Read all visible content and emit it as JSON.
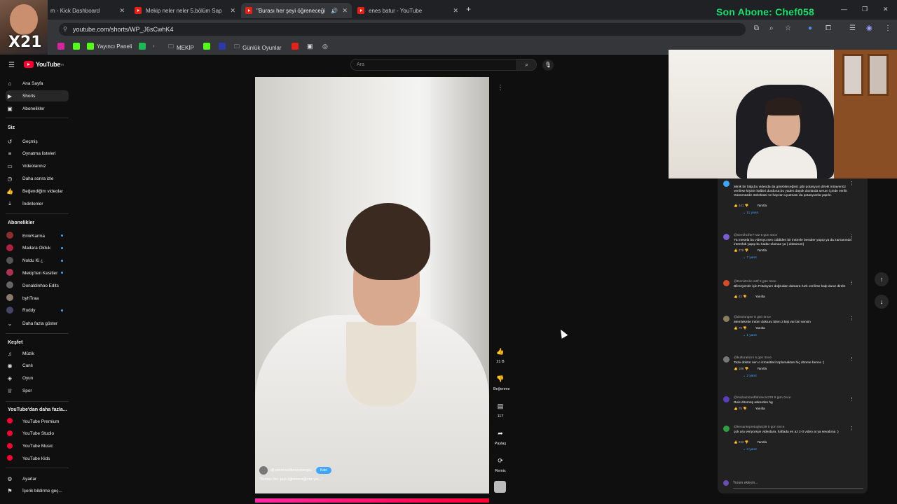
{
  "browser": {
    "tabs": [
      {
        "title": "m - Kick Dashboard",
        "close": "✕"
      },
      {
        "title": "Mekip neler neler 5.bölüm Sap",
        "close": "✕"
      },
      {
        "title": "\"Burası her şeyi öğreneceği",
        "close": "✕"
      },
      {
        "title": "enes batur - YouTube",
        "close": "✕"
      }
    ],
    "new_tab": "+",
    "url": "youtube.com/shorts/WP_J6sCwhK4",
    "bookmarks": [
      "Yayıncı Paneli",
      "MEKİP",
      "Günlük Oyunlar"
    ],
    "overlay_text": "Son Abone: Chef058",
    "window_controls": [
      "—",
      "❐",
      "✕"
    ],
    "facecam_label": "X21"
  },
  "youtube": {
    "logo": "YouTube",
    "logo_sup": "TR",
    "search_placeholder": "Ara",
    "sidebar": {
      "main": [
        {
          "label": "Ana Sayfa",
          "icon": "⌂"
        },
        {
          "label": "Shorts",
          "icon": "▶"
        },
        {
          "label": "Abonelikler",
          "icon": "▣"
        }
      ],
      "you_header": "Siz",
      "you": [
        {
          "label": "Geçmiş",
          "icon": "↺"
        },
        {
          "label": "Oynatma listeleri",
          "icon": "≡"
        },
        {
          "label": "Videolarınız",
          "icon": "▭"
        },
        {
          "label": "Daha sonra izle",
          "icon": "◷"
        },
        {
          "label": "Beğendiğim videolar",
          "icon": "👍"
        },
        {
          "label": "İndirilenler",
          "icon": "⤓"
        }
      ],
      "subs_header": "Abonelikler",
      "subs": [
        {
          "label": "EmirKarma",
          "color": "#8e2d2d",
          "dot": true
        },
        {
          "label": "Madara Olduk",
          "color": "#b02040",
          "dot": true
        },
        {
          "label": "Noldu Ki ¿",
          "color": "#555555",
          "dot": true
        },
        {
          "label": "Mekip'ten Kesitler",
          "color": "#b03050",
          "dot": true
        },
        {
          "label": "Donaldinhoo Edits",
          "color": "#666666",
          "dot": false
        },
        {
          "label": "byhTraa",
          "color": "#8a7a6a",
          "dot": false
        },
        {
          "label": "Ruddy",
          "color": "#444466",
          "dot": true
        }
      ],
      "show_more": "Daha fazla göster",
      "explore_header": "Keşfet",
      "explore": [
        {
          "label": "Müzik",
          "icon": "♫"
        },
        {
          "label": "Canlı",
          "icon": "◉"
        },
        {
          "label": "Oyun",
          "icon": "◈"
        },
        {
          "label": "Spor",
          "icon": "♕"
        }
      ],
      "more_header": "YouTube'dan daha fazla...",
      "more": [
        {
          "label": "YouTube Premium"
        },
        {
          "label": "YouTube Studio"
        },
        {
          "label": "YouTube Music"
        },
        {
          "label": "YouTube Kids"
        }
      ],
      "settings": [
        {
          "label": "Ayarlar",
          "icon": "⚙"
        },
        {
          "label": "İçerik bildirme geç...",
          "icon": "⚑"
        }
      ]
    },
    "short": {
      "channel": "@umutcandenizyasoglu",
      "subscribe": "Katıl",
      "caption": "\"Burası her şeyi öğreneceğimiz yer...\"",
      "likes": "21 B",
      "dislike": "Beğenme",
      "comments_count": "117",
      "share": "Paylaş",
      "remix": "Remix"
    },
    "comments": [
      {
        "user": "",
        "time": "",
        "text": "Minik bir bilgi,bu videoda da görebileceğiniz gibi potasyum direkt intravenöz verilirse kişinin kalbini durdurur,bu yüden düşük dozlarda serum içinde verilir. Günümüzde ötelektasi ve hayvan uyutması da potasyumla yapılır.",
        "likes": "441",
        "reply": "Yanıtla",
        "replies": "11 yanıt",
        "color": "#3ea6ff"
      },
      {
        "user": "@semihcifte7732",
        "time": "5 gün önce",
        "text": "Ya mesela bu videoyu sen ciddiden bir intörnle beraber yapıp ya da zamanında intörnlük yapıp bu kadar olamaz ya ( doktorum)",
        "likes": "276",
        "reply": "Yanıtla",
        "replies": "7 yanıt",
        "color": "#7b5cd6"
      },
      {
        "user": "@DenizKılıc-w8f",
        "time": "5 gün önce",
        "text": "Bilmeyenler için Potasyum doğrudan damara hızlı verilirse kalp durur direkt",
        "likes": "42",
        "reply": "Yanıtla",
        "replies": "",
        "color": "#d84a2a"
      },
      {
        "user": "@drstrongee",
        "time": "5 gün önce",
        "text": "Memlekette intöm dokturu bilen 3 kişi var biri sensin",
        "likes": "79",
        "reply": "Yanıtla",
        "replies": "1 yanıt",
        "color": "#8a8060"
      },
      {
        "user": "@kulturaticini",
        "time": "5 gün önce",
        "text": "Taze doktor sen o izmaritleri toplamaktan hiç dönme bence :)",
        "likes": "186",
        "reply": "Yanıtla",
        "replies": "2 yanıt",
        "color": "#777777"
      },
      {
        "user": "@muhammedfahrieci4378",
        "time": "5 gün önce",
        "text": "Reis dönmüş askerden hg",
        "likes": "75",
        "reply": "Yanıtla",
        "replies": "",
        "color": "#5a3cc0"
      },
      {
        "user": "@kenantepretoglu638",
        "time": "5 gün önce",
        "text": "çok ara veriyorsun videolara, haftada en az 2-3 video at ya sevabına :)",
        "likes": "242",
        "reply": "Yanıtla",
        "replies": "3 yanıt",
        "color": "#2f9e44"
      }
    ],
    "add_comment": "Yorum ekleyin...",
    "nav_up": "↑",
    "nav_down": "↓"
  }
}
